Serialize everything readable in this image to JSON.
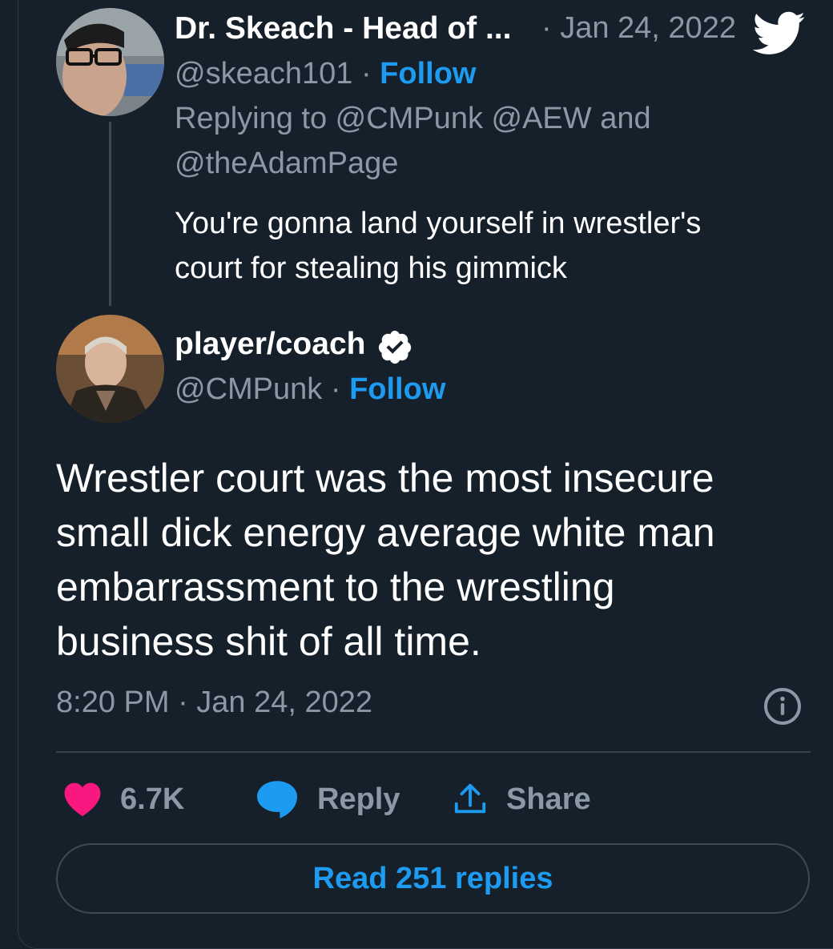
{
  "colors": {
    "background": "#15202b",
    "accent": "#1d9bf0",
    "muted": "#8b98a5",
    "like": "#f91880"
  },
  "reply_tweet": {
    "display_name": "Dr. Skeach - Head of ...",
    "date": "· Jan 24, 2022",
    "handle": "@skeach101",
    "separator": " · ",
    "follow_label": "Follow",
    "replying_line1": "Replying to @CMPunk @AEW and",
    "replying_line2": "@theAdamPage",
    "text_line1": "You're gonna land yourself in wrestler's",
    "text_line2": "court for stealing his gimmick",
    "logo_icon": "twitter-bird-icon"
  },
  "main_tweet": {
    "display_name": "player/coach",
    "verified_icon": "verified-badge-icon",
    "handle": "@CMPunk",
    "separator": " · ",
    "follow_label": "Follow",
    "text_line1": "Wrestler court was the most insecure",
    "text_line2": "small dick energy average white man",
    "text_line3": "embarrassment to the wrestling",
    "text_line4": "business shit of all time.",
    "timestamp": "8:20 PM · Jan 24, 2022",
    "info_icon": "info-icon"
  },
  "actions": {
    "like_count": "6.7K",
    "reply_label": "Reply",
    "share_label": "Share"
  },
  "read_replies_label": "Read 251 replies"
}
